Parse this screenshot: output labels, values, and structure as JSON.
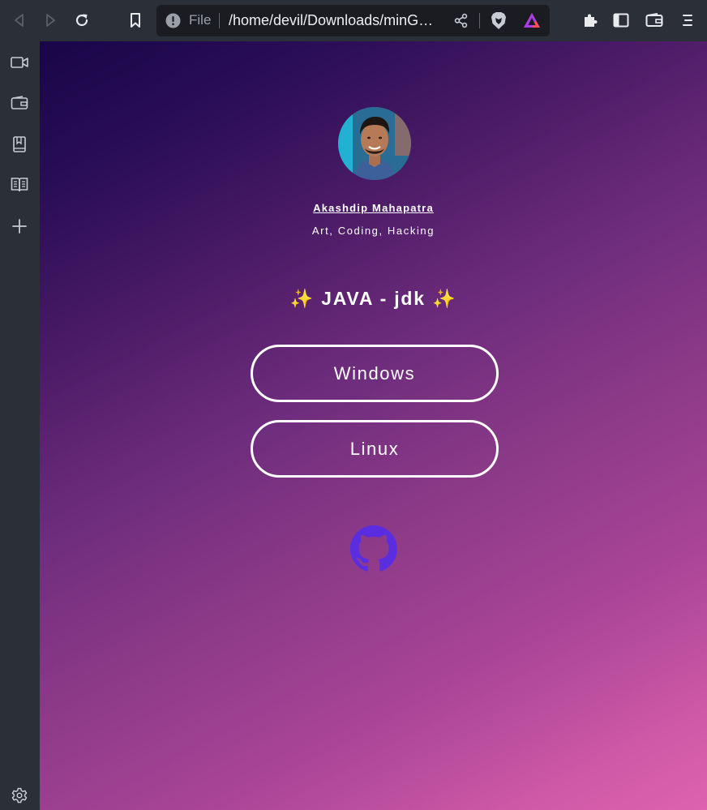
{
  "browser": {
    "url_scheme_label": "File",
    "url": "/home/devil/Downloads/minG…"
  },
  "sidebar": {
    "items": [
      {
        "icon": "video-icon"
      },
      {
        "icon": "wallet-icon"
      },
      {
        "icon": "bookmarks-icon"
      },
      {
        "icon": "reading-list-icon"
      },
      {
        "icon": "add-icon"
      }
    ],
    "settings_icon": "gear-icon"
  },
  "profile": {
    "name": "Akashdip Mahapatra",
    "bio": "Art, Coding, Hacking"
  },
  "page": {
    "heading": "✨ JAVA - jdk ✨",
    "links": [
      {
        "label": "Windows"
      },
      {
        "label": "Linux"
      }
    ],
    "footer_icon": "github-icon"
  },
  "colors": {
    "toolbar_bg": "#2b2f38",
    "gradient_start": "#1a0548",
    "gradient_end": "#de62ae",
    "github_icon": "#5a2ee0"
  }
}
